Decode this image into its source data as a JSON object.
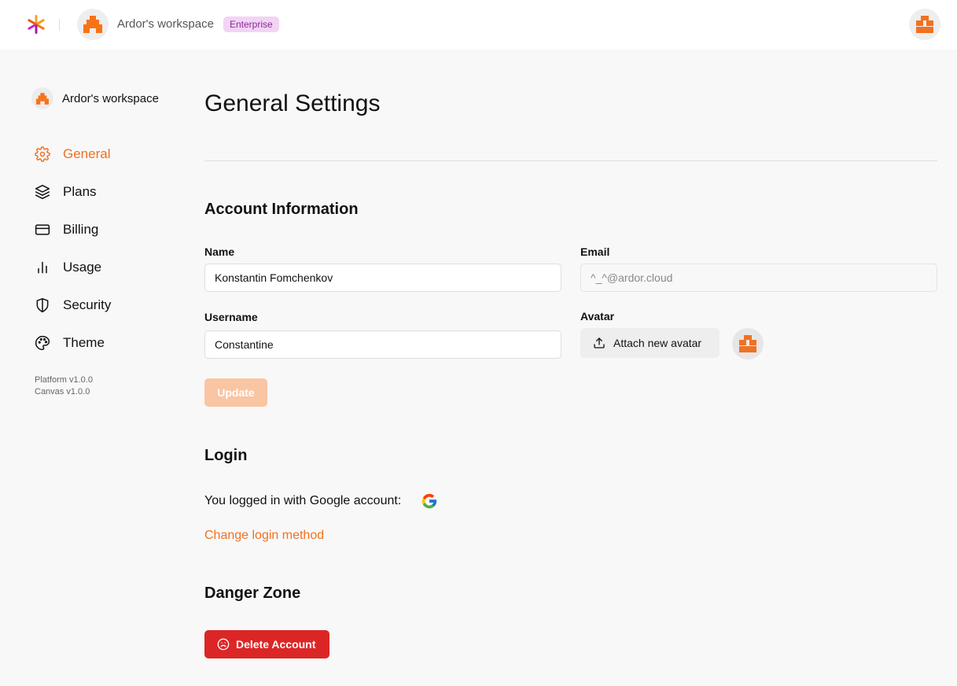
{
  "colors": {
    "accent": "#f07122",
    "danger": "#dc2626",
    "badge_bg": "#f2d4f5",
    "badge_text": "#8a2a94",
    "update_disabled": "#f9c5a3"
  },
  "header": {
    "workspace_name": "Ardor's workspace",
    "plan_badge": "Enterprise",
    "logo_icon": "asterisk-logo-icon",
    "user_avatar_icon": "pixel-avatar-icon"
  },
  "sidebar": {
    "workspace_name": "Ardor's workspace",
    "items": [
      {
        "label": "General",
        "icon": "gear-icon",
        "active": true
      },
      {
        "label": "Plans",
        "icon": "layers-icon",
        "active": false
      },
      {
        "label": "Billing",
        "icon": "credit-card-icon",
        "active": false
      },
      {
        "label": "Usage",
        "icon": "bar-chart-icon",
        "active": false
      },
      {
        "label": "Security",
        "icon": "shield-icon",
        "active": false
      },
      {
        "label": "Theme",
        "icon": "palette-icon",
        "active": false
      }
    ],
    "versions": [
      "Platform v1.0.0",
      "Canvas v1.0.0"
    ]
  },
  "main": {
    "title": "General Settings",
    "account": {
      "title": "Account Information",
      "name_label": "Name",
      "name_value": "Konstantin Fomchenkov",
      "email_label": "Email",
      "email_value": "^_^@ardor.cloud",
      "username_label": "Username",
      "username_value": "Constantine",
      "avatar_label": "Avatar",
      "attach_label": "Attach new avatar",
      "update_label": "Update"
    },
    "login": {
      "title": "Login",
      "text": "You logged in with Google account:",
      "change_label": "Change login method"
    },
    "danger": {
      "title": "Danger Zone",
      "delete_label": "Delete Account"
    }
  }
}
